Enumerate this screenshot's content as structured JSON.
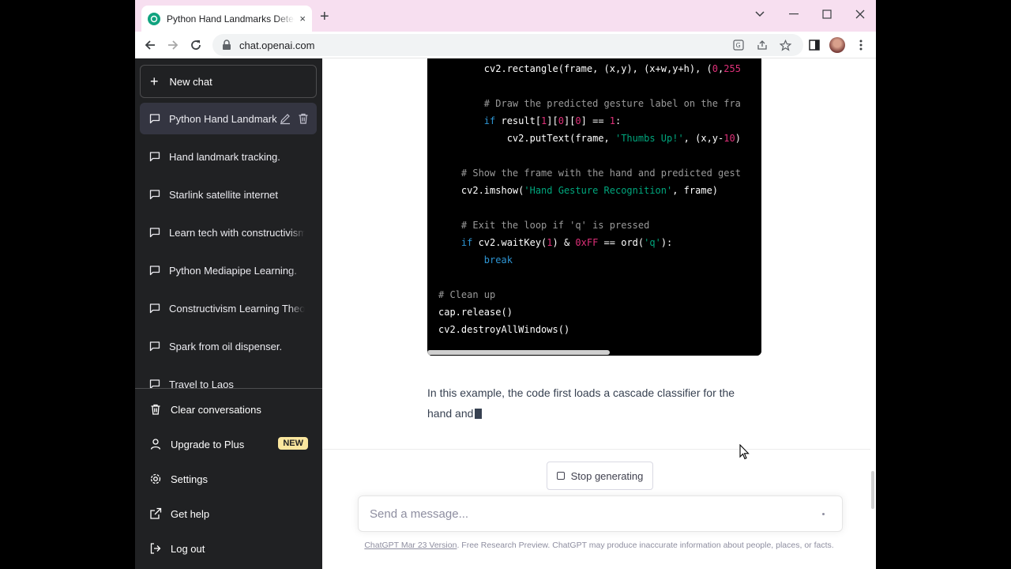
{
  "browser": {
    "tab_title": "Python Hand Landmarks Detection",
    "tab_close": "×",
    "new_tab": "+",
    "url": "chat.openai.com",
    "window_controls": [
      "chevron-down-icon",
      "minimize-icon",
      "maximize-icon",
      "close-icon"
    ]
  },
  "sidebar": {
    "new_chat_label": "New chat",
    "conversations": [
      "Python Hand Landmark",
      "Hand landmark tracking.",
      "Starlink satellite internet",
      "Learn tech with constructivism",
      "Python Mediapipe Learning.",
      "Constructivism Learning Theory",
      "Spark from oil dispenser.",
      "Travel to Laos"
    ],
    "menu": {
      "clear": "Clear conversations",
      "upgrade": "Upgrade to Plus",
      "upgrade_badge": "NEW",
      "settings": "Settings",
      "help": "Get help",
      "logout": "Log out"
    }
  },
  "main": {
    "answer_text": "In this example, the code first loads a cascade classifier for the hand and",
    "stop_label": "Stop generating",
    "input_placeholder": "Send a message...",
    "footer_link": "ChatGPT Mar 23 Version",
    "footer_text": ". Free Research Preview. ChatGPT may produce inaccurate information about people, places, or facts."
  },
  "colors": {
    "sidebar_bg": "#202123",
    "active_item": "#343541",
    "code_bg": "#000000",
    "tabstrip": "#f7dff0",
    "badge": "#fae69e"
  }
}
